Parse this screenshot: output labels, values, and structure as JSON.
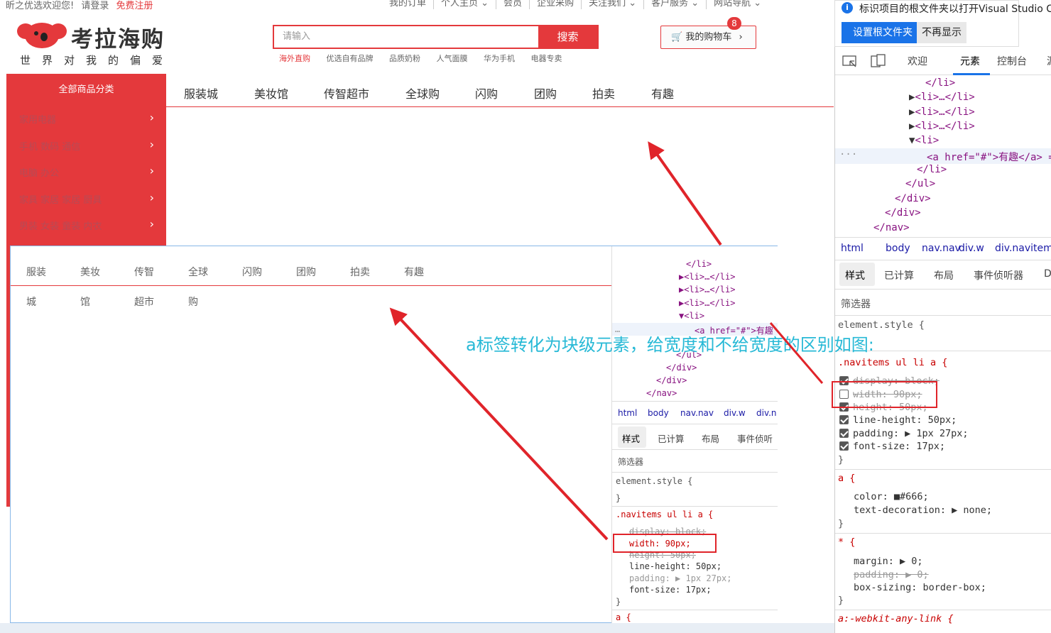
{
  "topbar": {
    "welcome": "昕之优选欢迎您!",
    "login": "请登录",
    "register": "免费注册",
    "links": [
      "我的订单",
      "个人主页 ⌄",
      "会员",
      "企业采购",
      "关注我们 ⌄",
      "客户服务 ⌄",
      "网站导航 ⌄"
    ]
  },
  "logo": {
    "name": "考拉海购",
    "slogan": "世界对我的偏爱"
  },
  "search": {
    "placeholder": "请输入",
    "button": "搜索",
    "hotwords": [
      "海外直购",
      "优选自有品牌",
      "品质奶粉",
      "人气面膜",
      "华为手机",
      "电器专卖"
    ]
  },
  "cart": {
    "label": "我的购物车",
    "count": "8"
  },
  "category": {
    "title": "全部商品分类",
    "items": [
      "家用电器",
      "手机  数码  通信",
      "电脑  办公",
      "家具  家居  家居  厨具",
      "男装  女装  童装  内衣"
    ]
  },
  "mainnav": [
    "服装城",
    "美妆馆",
    "传智超市",
    "全球购",
    "闪购",
    "团购",
    "拍卖",
    "有趣"
  ],
  "inner": {
    "nav": [
      "服装",
      "美妆",
      "传智",
      "全球",
      "闪购",
      "团购",
      "拍卖",
      "有趣"
    ],
    "wrap": [
      "城",
      "馆",
      "超市",
      "购"
    ],
    "dom": [
      "</li>",
      "<li>…</li>",
      "<li>…</li>",
      "<li>…</li>",
      "<li>",
      "<a href=\"#\">有趣",
      "</ul>",
      "</div>",
      "</div>",
      "</nav>"
    ],
    "breadcrumb": [
      "html",
      "body",
      "nav.nav",
      "div.w",
      "div.n"
    ],
    "tabs": [
      "样式",
      "已计算",
      "布局",
      "事件侦听"
    ],
    "filter": "筛选器",
    "element_style": "element.style {",
    "close": "}",
    "selector": ".navitems ul li a {",
    "props": [
      "display: block;",
      "width: 90px;",
      "height: 50px;",
      "line-height: 50px;",
      "padding: ▶ 1px 27px;",
      "font-size: 17px;"
    ],
    "a_rule": "a {"
  },
  "popup": {
    "message": "标识项目的根文件夹以打开Visual Studio C",
    "primary": "设置根文件夹",
    "secondary": "不再显示"
  },
  "devtools": {
    "tabs": [
      "欢迎",
      "元素",
      "控制台",
      "源"
    ],
    "dom": [
      "</li>",
      "<li>…</li>",
      "<li>…</li>",
      "<li>…</li>",
      "<li>",
      "<a href=\"#\">有趣</a> =",
      "</li>",
      "</ul>",
      "</div>",
      "</div>",
      "</nav>"
    ],
    "breadcrumb": [
      "html",
      "body",
      "nav.nav",
      "div.w",
      "div.navitems"
    ],
    "subtabs": [
      "样式",
      "已计算",
      "布局",
      "事件侦听器",
      "D"
    ],
    "filter": "筛选器",
    "element_style": "element.style {",
    "selector": ".navitems ul li a {",
    "props": [
      "display: block;",
      "width: 90px;",
      "height: 50px;",
      "line-height: 50px;",
      "padding: ▶ 1px 27px;",
      "font-size: 17px;"
    ],
    "close": "}",
    "a_rule": "a {",
    "a_props": [
      "color: ■#666;",
      "text-decoration: ▶ none;"
    ],
    "star_rule": "* {",
    "star_props": [
      "margin: ▶ 0;",
      "padding: ▶ 0;",
      "box-sizing: border-box;"
    ],
    "webkit_rule": "a:-webkit-any-link {"
  },
  "annotation": "a标签转化为块级元素，给宽度和不给宽度的区别如图:",
  "colors": {
    "brand": "#e4393c",
    "annotation": "#27b9d6",
    "arrow": "#e0242a",
    "devtools_accent": "#1a73e8"
  }
}
